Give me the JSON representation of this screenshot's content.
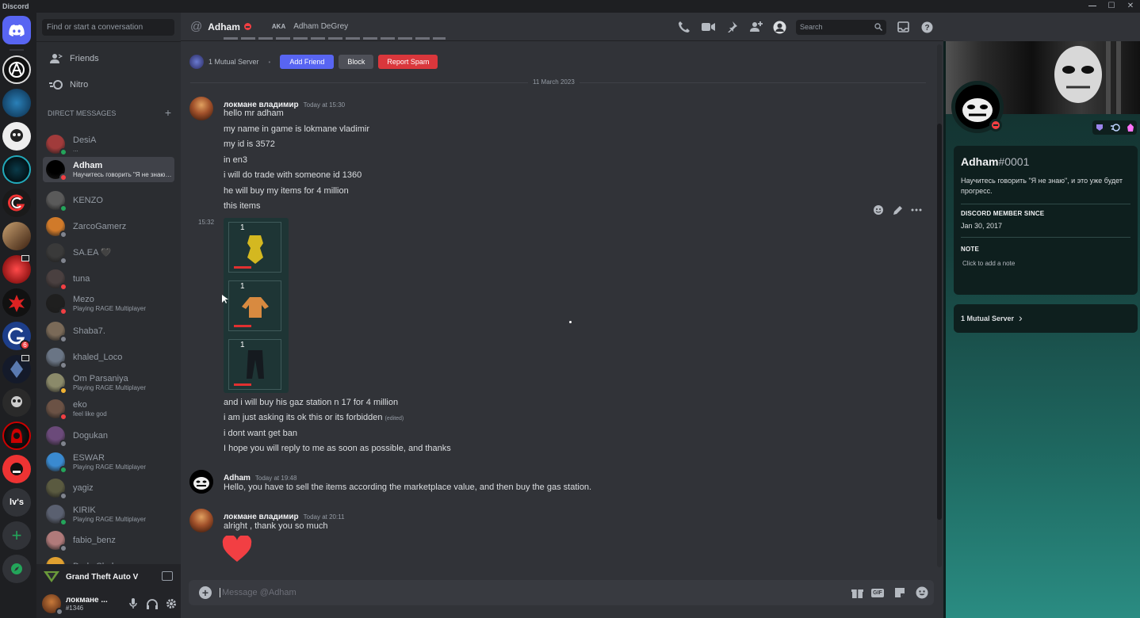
{
  "window": {
    "title": "Discord",
    "controls": [
      "—",
      "☐",
      "✕"
    ]
  },
  "guilds": {
    "home_label": "Direct Messages",
    "folder_label": "lv's",
    "unread_badge": "6",
    "add_label": "+",
    "explore_label": "Explore"
  },
  "sidebar": {
    "search_placeholder": "Find or start a conversation",
    "friends_label": "Friends",
    "nitro_label": "Nitro",
    "dm_header": "DIRECT MESSAGES",
    "dm_add": "+",
    "dms": [
      {
        "name": "DesiA",
        "sub": "...",
        "status": "online",
        "color": "#a13b3b"
      },
      {
        "name": "Adham",
        "sub": "Научитесь говорить \"Я не знаю\", и это уже будет прогресс.",
        "status": "dnd",
        "color": "#000000"
      },
      {
        "name": "KENZO",
        "sub": "",
        "status": "online",
        "color": "#5a5a5a"
      },
      {
        "name": "ZarcoGamerz",
        "sub": "",
        "status": "offline",
        "color": "#d07a2a"
      },
      {
        "name": "SA.EA 🖤",
        "sub": "",
        "status": "offline",
        "color": "#3a3a3a"
      },
      {
        "name": "tuna",
        "sub": "",
        "status": "dnd",
        "color": "#4a4040"
      },
      {
        "name": "Mezo",
        "sub": "Playing RAGE Multiplayer",
        "status": "dnd",
        "color": "#1f1f1f"
      },
      {
        "name": "Shaba7.",
        "sub": "",
        "status": "offline",
        "color": "#7a6a58"
      },
      {
        "name": "khaled_Loco",
        "sub": "",
        "status": "offline",
        "color": "#6a7585"
      },
      {
        "name": "Om Parsaniya",
        "sub": "Playing RAGE Multiplayer",
        "status": "idle",
        "color": "#8b8a6a"
      },
      {
        "name": "eko",
        "sub": "feel like god",
        "status": "dnd",
        "color": "#6b5245"
      },
      {
        "name": "Dogukan",
        "sub": "",
        "status": "offline",
        "color": "#6b4a7a"
      },
      {
        "name": "ESWAR",
        "sub": "Playing RAGE Multiplayer",
        "status": "online",
        "color": "#3a8ad0"
      },
      {
        "name": "yagiz",
        "sub": "",
        "status": "offline",
        "color": "#5a5a40"
      },
      {
        "name": "KIRIK",
        "sub": "Playing RAGE Multiplayer",
        "status": "online",
        "color": "#5a6070"
      },
      {
        "name": "fabio_benz",
        "sub": "",
        "status": "offline",
        "color": "#b07a7a"
      },
      {
        "name": "Dodo Shakur",
        "sub": "",
        "status": "offline",
        "color": "#e0a030"
      }
    ],
    "game_activity": "Grand Theft Auto V",
    "user": {
      "name": "локмане ...",
      "tag": "#1346"
    }
  },
  "header": {
    "at_symbol": "@",
    "username": "Adham",
    "aka_label": "AKA",
    "aka_value": "Adham DeGrey",
    "search_placeholder": "Search"
  },
  "relationship": {
    "mutual_servers": "1 Mutual Server",
    "separator": "•",
    "add_friend": "Add Friend",
    "block": "Block",
    "report_spam": "Report Spam"
  },
  "divider_date": "11 March 2023",
  "messages": [
    {
      "author": "локмане владимир",
      "time": "Today at 15:30",
      "lines": [
        "hello mr adham",
        "my name in game is lokmane vladimir",
        "my id is 3572",
        "in en3",
        "i will do trade with someone id 1360",
        "he will buy my items for 4 million",
        "this items"
      ]
    },
    {
      "hover_time": "15:32",
      "items": [
        {
          "qty": "1"
        },
        {
          "qty": "1"
        },
        {
          "qty": "1"
        }
      ]
    },
    {
      "lines": [
        "and i will buy his gaz station n 17 for 4 million",
        "i am just asking its ok this or its forbidden",
        "i dont want get ban",
        "I hope you will reply to me as soon as possible,  and thanks"
      ],
      "edited_label": "(edited)"
    },
    {
      "author": "Adham",
      "time": "Today at 19:48",
      "lines": [
        "Hello, you have to sell the items according the marketplace value, and then buy the gas station."
      ]
    },
    {
      "author": "локмане владимир",
      "time": "Today at 20:11",
      "lines": [
        "alright , thank you so much"
      ],
      "reaction": "❤"
    }
  ],
  "composer": {
    "placeholder": "Message @Adham",
    "add": "+",
    "gif_label": "GIF"
  },
  "profile": {
    "username": "Adham",
    "discriminator": "#0001",
    "bio": "Научитесь говорить \"Я не знаю\", и это уже будет прогресс.",
    "member_since_label": "DISCORD MEMBER SINCE",
    "member_since": "Jan 30, 2017",
    "note_label": "NOTE",
    "note_placeholder": "Click to add a note",
    "mutual_servers": "1 Mutual Server",
    "chevron": "›"
  },
  "colors": {
    "blurple": "#5865f2",
    "red": "#da373c",
    "online": "#23a55a",
    "idle": "#f0b232",
    "dnd": "#f23f43",
    "offline": "#80848e",
    "heart": "#f23f43"
  }
}
